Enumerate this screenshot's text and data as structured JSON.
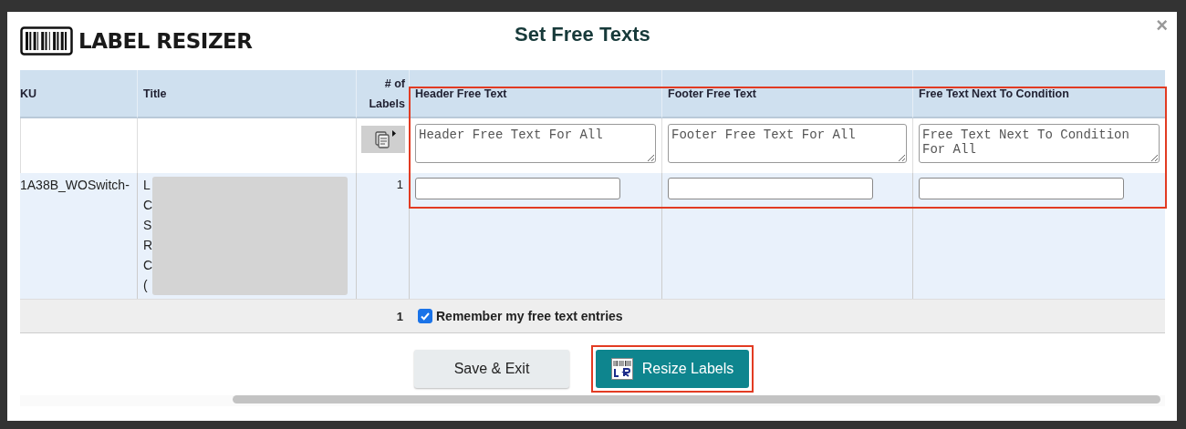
{
  "logo": {
    "text": "LABEL RESIZER"
  },
  "title": "Set Free Texts",
  "close": "×",
  "table": {
    "columns": [
      "KU",
      "Title",
      "# of Labels",
      "Header Free Text",
      "Footer Free Text",
      "Free Text Next To Condition"
    ],
    "free_text_highlighted": true,
    "all_row": {
      "placeholders": [
        "Header Free Text For All",
        "Footer Free Text For All",
        "Free Text Next To Condition For All"
      ]
    },
    "rows": [
      {
        "sku": "1A38B_WOSwitch-",
        "title_lines": [
          "L",
          "C",
          "S",
          "R",
          "C",
          "("
        ],
        "title_redacted": true,
        "labels": "1"
      }
    ],
    "total": "1",
    "remember": {
      "label": "Remember my free text entries",
      "checked": true
    }
  },
  "buttons": [
    {
      "label": "Save & Exit",
      "kind": "secondary",
      "highlighted": false
    },
    {
      "label": "Resize Labels",
      "kind": "primary",
      "highlighted": true
    }
  ]
}
